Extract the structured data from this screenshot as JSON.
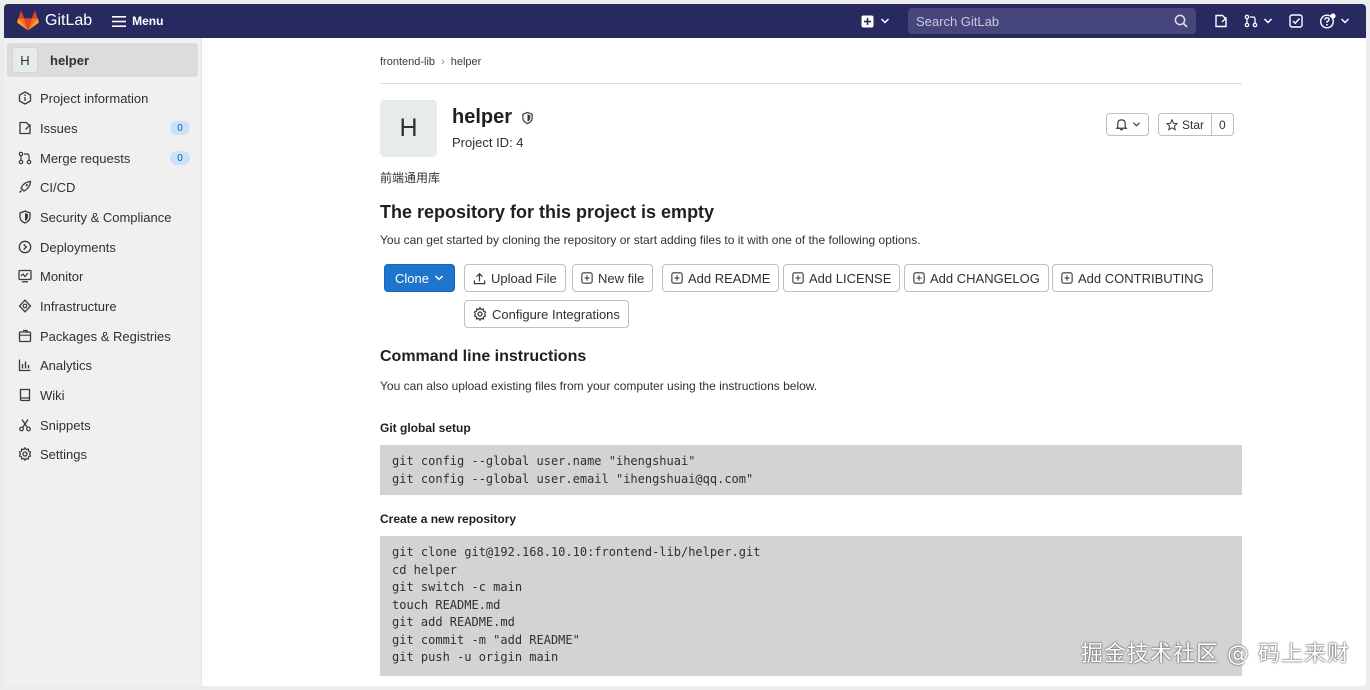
{
  "topbar": {
    "brand": "GitLab",
    "menu_label": "Menu",
    "search_placeholder": "Search GitLab"
  },
  "sidebar": {
    "project_initial": "H",
    "project_name": "helper",
    "items": [
      {
        "label": "Project information",
        "icon": "info-icon"
      },
      {
        "label": "Issues",
        "icon": "issues-icon",
        "count": "0"
      },
      {
        "label": "Merge requests",
        "icon": "merge-request-icon",
        "count": "0"
      },
      {
        "label": "CI/CD",
        "icon": "rocket-icon"
      },
      {
        "label": "Security & Compliance",
        "icon": "shield-icon"
      },
      {
        "label": "Deployments",
        "icon": "deployments-icon"
      },
      {
        "label": "Monitor",
        "icon": "monitor-icon"
      },
      {
        "label": "Infrastructure",
        "icon": "infrastructure-icon"
      },
      {
        "label": "Packages & Registries",
        "icon": "package-icon"
      },
      {
        "label": "Analytics",
        "icon": "chart-icon"
      },
      {
        "label": "Wiki",
        "icon": "book-icon"
      },
      {
        "label": "Snippets",
        "icon": "snippet-icon"
      },
      {
        "label": "Settings",
        "icon": "settings-icon"
      }
    ]
  },
  "breadcrumb": {
    "group": "frontend-lib",
    "project": "helper"
  },
  "project": {
    "initial": "H",
    "name": "helper",
    "id_text": "Project ID: 4",
    "description": "前端通用库",
    "star_label": "Star",
    "star_count": "0"
  },
  "empty": {
    "title": "The repository for this project is empty",
    "subtitle": "You can get started by cloning the repository or start adding files to it with one of the following options."
  },
  "actions": {
    "clone": "Clone",
    "upload": "Upload File",
    "new_file": "New file",
    "readme": "Add README",
    "license": "Add LICENSE",
    "changelog": "Add CHANGELOG",
    "contributing": "Add CONTRIBUTING",
    "integrations": "Configure Integrations"
  },
  "cli": {
    "title": "Command line instructions",
    "subtitle": "You can also upload existing files from your computer using the instructions below.",
    "global_title": "Git global setup",
    "global_lines": [
      "git config --global user.name \"ihengshuai\"",
      "git config --global user.email \"ihengshuai@qq.com\""
    ],
    "new_repo_title": "Create a new repository",
    "new_repo_lines": [
      "git clone git@192.168.10.10:frontend-lib/helper.git",
      "cd helper",
      "git switch -c main",
      "touch README.md",
      "git add README.md",
      "git commit -m \"add README\"",
      "git push -u origin main"
    ]
  },
  "watermark": "掘金技术社区 @ 码上来财",
  "colors": {
    "topbar": "#292961",
    "primary": "#1f75cb",
    "sidebar": "#f0f0f0",
    "code_bg": "#d3d3d3",
    "logo_orange": "#e24329"
  }
}
